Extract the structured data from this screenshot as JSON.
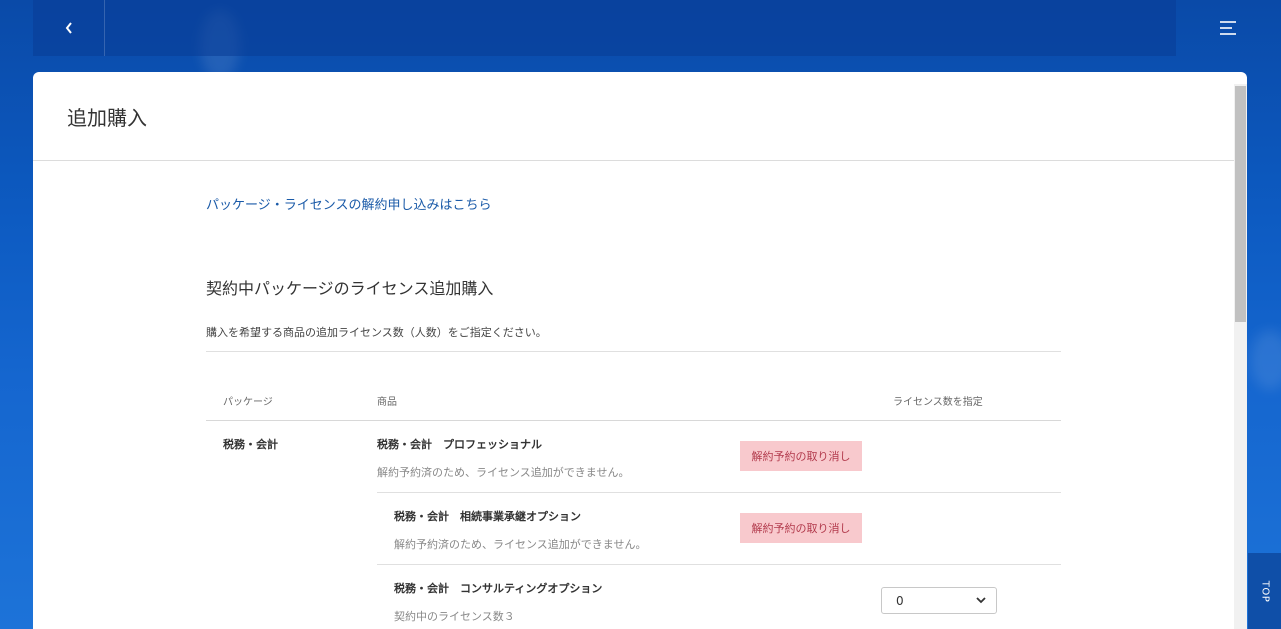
{
  "header": {
    "back_icon": "chevron-left-icon",
    "menu_icon": "menu-icon",
    "top_link": "TOP"
  },
  "page": {
    "title": "追加購入"
  },
  "main": {
    "cancel_link": "パッケージ・ライセンスの解約申し込みはこちら",
    "section_title": "契約中パッケージのライセンス追加購入",
    "section_desc": "購入を希望する商品の追加ライセンス数（人数）をご指定ください。",
    "table": {
      "headers": {
        "package": "パッケージ",
        "product": "商品",
        "license": "ライセンス数を指定"
      },
      "package_name": "税務・会計",
      "rows": [
        {
          "name": "税務・会計　プロフェッショナル",
          "note": "解約予約済のため、ライセンス追加ができません。",
          "action": "解約予約の取り消し"
        },
        {
          "name": "税務・会計　相続事業承継オプション",
          "note": "解約予約済のため、ライセンス追加ができません。",
          "action": "解約予約の取り消し"
        },
        {
          "name": "税務・会計　コンサルティングオプション",
          "note": "契約中のライセンス数３",
          "select_value": "0"
        }
      ]
    }
  },
  "colors": {
    "link": "#1a5aa8",
    "cancel_button_bg": "#f8c9cd",
    "cancel_button_text": "#b23a4c"
  }
}
